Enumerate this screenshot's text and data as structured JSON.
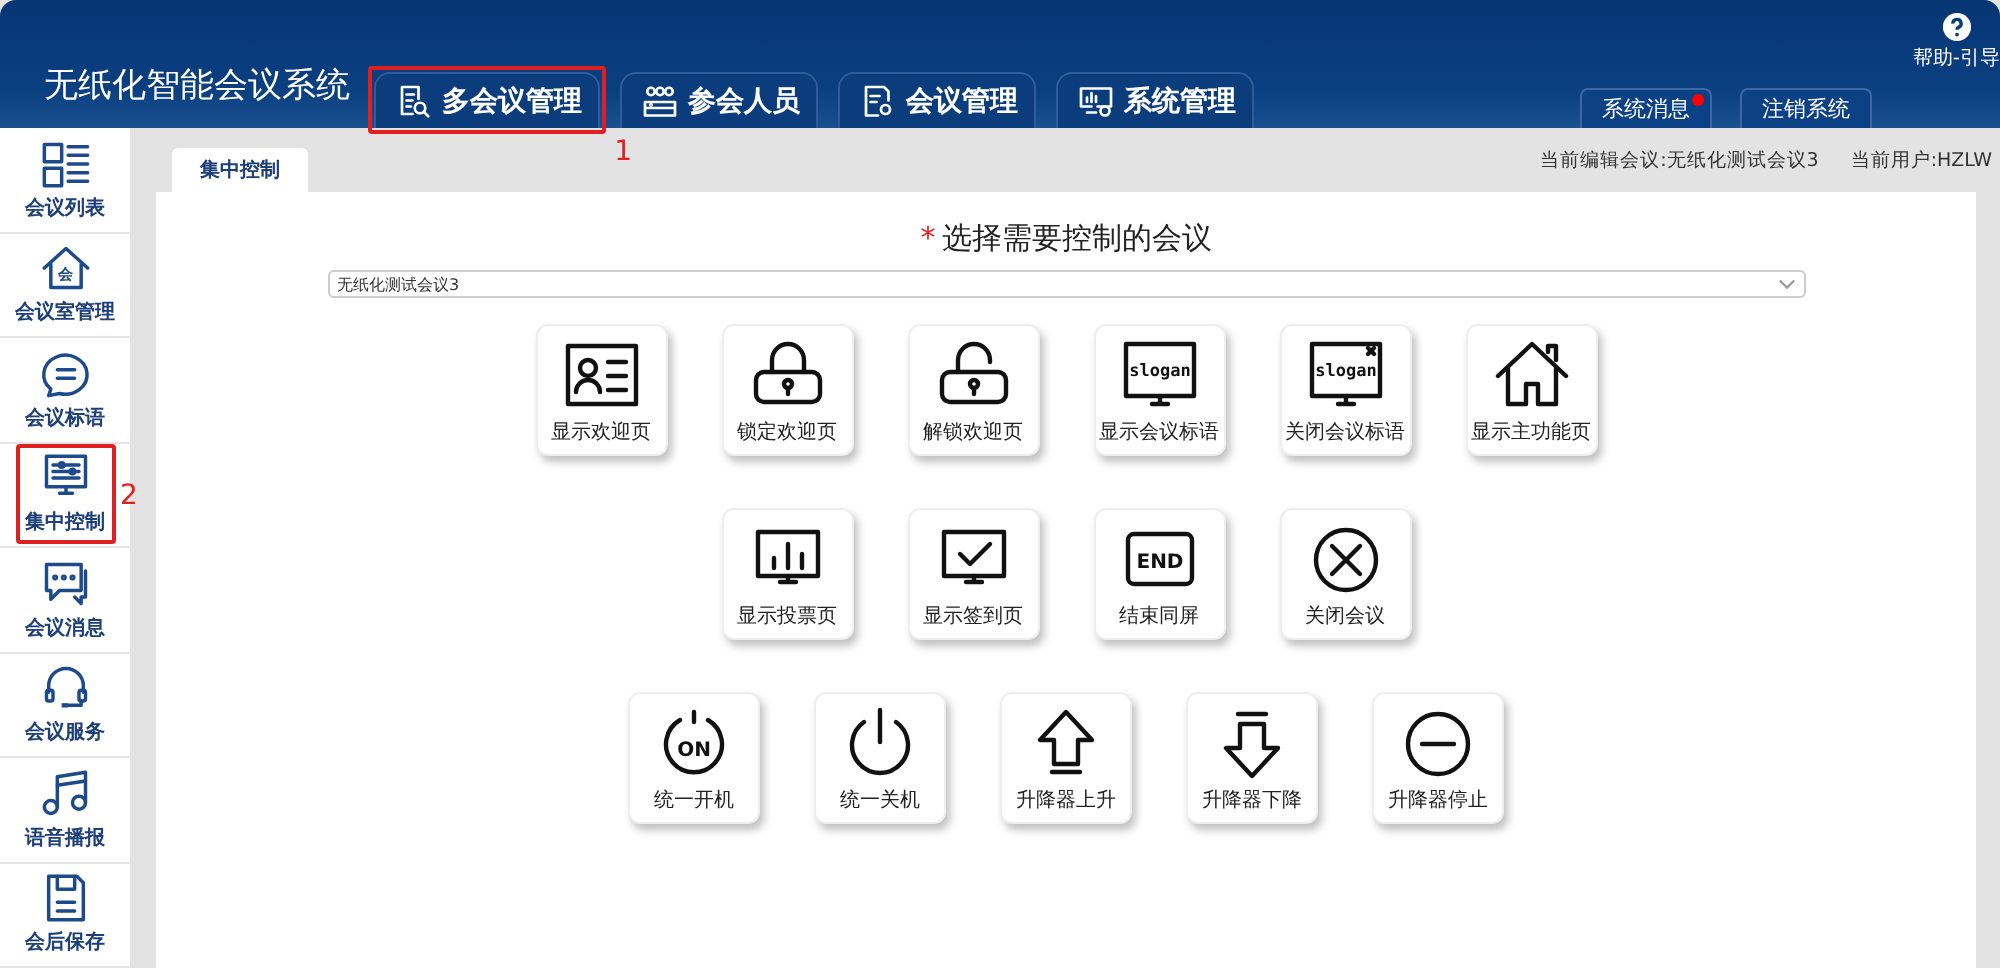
{
  "app_title": "无纸化智能会议系统",
  "nav_tabs": [
    {
      "label": "多会议管理",
      "kind": "doc-search",
      "callout": "1"
    },
    {
      "label": "参会人员",
      "kind": "people"
    },
    {
      "label": "会议管理",
      "kind": "doc-settings"
    },
    {
      "label": "系统管理",
      "kind": "monitor-gear"
    }
  ],
  "help": {
    "label": "帮助-引导"
  },
  "header_buttons": [
    {
      "label": "系统消息",
      "unread": true
    },
    {
      "label": "注销系统",
      "unread": false
    }
  ],
  "sidebar": [
    {
      "label": "会议列表",
      "kind": "list"
    },
    {
      "label": "会议室管理",
      "kind": "house",
      "icon_text": "会"
    },
    {
      "label": "会议标语",
      "kind": "bubble"
    },
    {
      "label": "集中控制",
      "kind": "control",
      "callout": "2"
    },
    {
      "label": "会议消息",
      "kind": "chat"
    },
    {
      "label": "会议服务",
      "kind": "headset"
    },
    {
      "label": "语音播报",
      "kind": "music"
    },
    {
      "label": "会后保存",
      "kind": "floppy"
    }
  ],
  "page_tab": {
    "label": "集中控制"
  },
  "current_meeting": "当前编辑会议:无纸化测试会议3",
  "current_user": "当前用户:HZLW",
  "prompt": {
    "required_mark": "*",
    "text": "选择需要控制的会议"
  },
  "meeting_select": {
    "value": "无纸化测试会议3"
  },
  "button_rows": [
    [
      {
        "label": "显示欢迎页",
        "kind": "idcard"
      },
      {
        "label": "锁定欢迎页",
        "kind": "lock"
      },
      {
        "label": "解锁欢迎页",
        "kind": "unlock"
      },
      {
        "label": "显示会议标语",
        "kind": "monitor-text",
        "icon_text": "slogan"
      },
      {
        "label": "关闭会议标语",
        "kind": "monitor-text-close",
        "icon_text": "slogan"
      },
      {
        "label": "显示主功能页",
        "kind": "home"
      }
    ],
    [
      {
        "label": "显示投票页",
        "kind": "chart"
      },
      {
        "label": "显示签到页",
        "kind": "check"
      },
      {
        "label": "结束同屏",
        "kind": "end",
        "icon_text": "END"
      },
      {
        "label": "关闭会议",
        "kind": "circle-x"
      }
    ],
    [
      {
        "label": "统一开机",
        "kind": "on",
        "icon_text": "ON"
      },
      {
        "label": "统一关机",
        "kind": "power"
      },
      {
        "label": "升降器上升",
        "kind": "up"
      },
      {
        "label": "升降器下降",
        "kind": "down"
      },
      {
        "label": "升降器停止",
        "kind": "minus"
      }
    ]
  ]
}
